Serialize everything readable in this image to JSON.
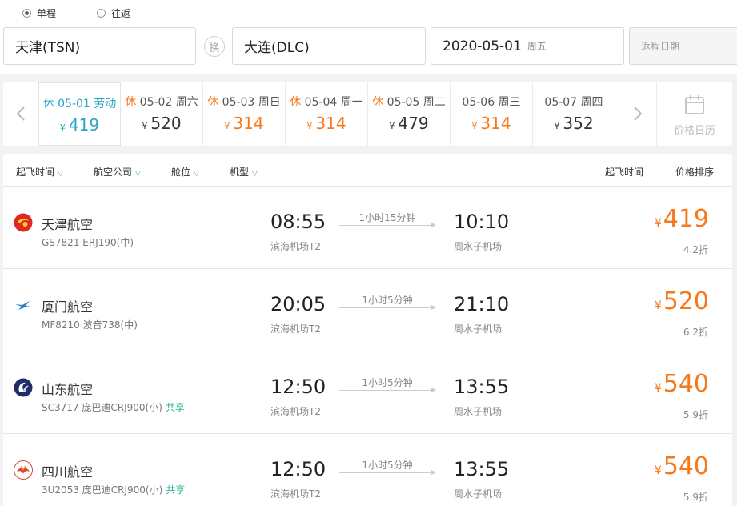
{
  "search": {
    "trip_one_way": "单程",
    "trip_round": "往返",
    "from": "天津(TSN)",
    "swap": "换",
    "to": "大连(DLC)",
    "depart_date": "2020-05-01",
    "depart_weekday": "周五",
    "return_placeholder": "返程日期"
  },
  "dates": [
    {
      "hol": "休",
      "date": "05-01 劳动",
      "yen": "¥",
      "price": "419",
      "price_color": "#29a4c4",
      "selected": true
    },
    {
      "hol": "休",
      "date": "05-02 周六",
      "yen": "¥",
      "price": "520",
      "price_color": "#333333"
    },
    {
      "hol": "休",
      "date": "05-03 周日",
      "yen": "¥",
      "price": "314",
      "price_color": "#f57a1e"
    },
    {
      "hol": "休",
      "date": "05-04 周一",
      "yen": "¥",
      "price": "314",
      "price_color": "#f57a1e"
    },
    {
      "hol": "休",
      "date": "05-05 周二",
      "yen": "¥",
      "price": "479",
      "price_color": "#333333"
    },
    {
      "hol": "",
      "date": "05-06 周三",
      "yen": "¥",
      "price": "314",
      "price_color": "#f57a1e"
    },
    {
      "hol": "",
      "date": "05-07 周四",
      "yen": "¥",
      "price": "352",
      "price_color": "#333333"
    }
  ],
  "calendar_label": "价格日历",
  "filters": {
    "dep_time": "起飞时间",
    "airline": "航空公司",
    "cabin": "舱位",
    "aircraft": "机型",
    "sort_time": "起飞时间",
    "sort_price": "价格排序"
  },
  "flights": [
    {
      "airline": "天津航空",
      "flight_no": "GS7821 ERJ190(中)",
      "share": "",
      "dep_time": "08:55",
      "dep_airport": "滨海机场T2",
      "duration": "1小时15分钟",
      "arr_time": "10:10",
      "arr_airport": "周水子机场",
      "yen": "¥",
      "price": "419",
      "discount": "4.2折",
      "logo": "tianjin-airlines-logo"
    },
    {
      "airline": "厦门航空",
      "flight_no": "MF8210 波音738(中)",
      "share": "",
      "dep_time": "20:05",
      "dep_airport": "滨海机场T2",
      "duration": "1小时5分钟",
      "arr_time": "21:10",
      "arr_airport": "周水子机场",
      "yen": "¥",
      "price": "520",
      "discount": "6.2折",
      "logo": "xiamen-airlines-logo"
    },
    {
      "airline": "山东航空",
      "flight_no": "SC3717 庞巴迪CRJ900(小)",
      "share": "共享",
      "dep_time": "12:50",
      "dep_airport": "滨海机场T2",
      "duration": "1小时5分钟",
      "arr_time": "13:55",
      "arr_airport": "周水子机场",
      "yen": "¥",
      "price": "540",
      "discount": "5.9折",
      "logo": "shandong-airlines-logo"
    },
    {
      "airline": "四川航空",
      "flight_no": "3U2053 庞巴迪CRJ900(小)",
      "share": "共享",
      "dep_time": "12:50",
      "dep_airport": "滨海机场T2",
      "duration": "1小时5分钟",
      "arr_time": "13:55",
      "arr_airport": "周水子机场",
      "yen": "¥",
      "price": "540",
      "discount": "5.9折",
      "logo": "sichuan-airlines-logo"
    }
  ],
  "colors": {
    "accent": "#29a4c4",
    "price": "#f57a1e",
    "share": "#2bb59a"
  }
}
